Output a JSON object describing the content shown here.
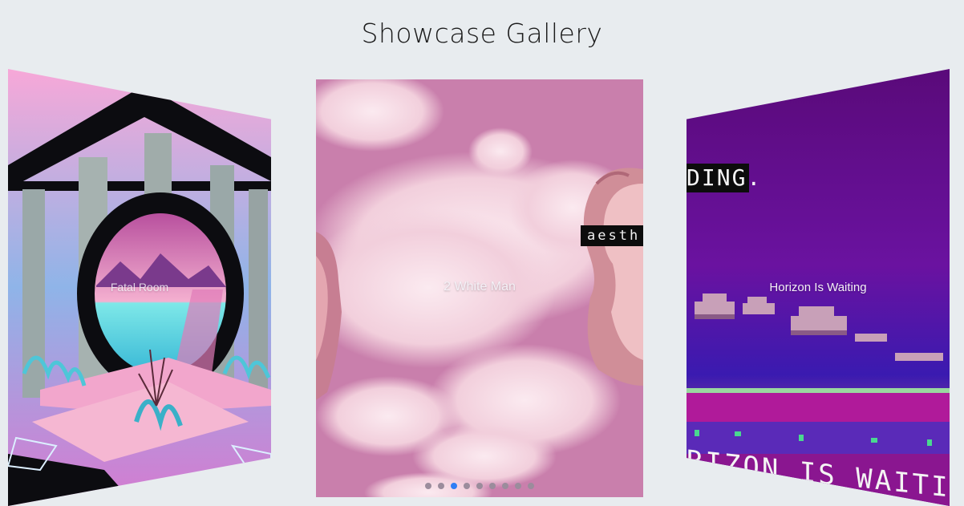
{
  "page": {
    "title": "Showcase Gallery"
  },
  "slides": [
    {
      "caption": "Fatal Room"
    },
    {
      "caption": "2 White Man",
      "overlay_text": "aesth"
    },
    {
      "caption": "Horizon Is Waiting",
      "top_text": "DING.",
      "bottom_text": "RIZON IS WAITING"
    }
  ],
  "pagination": {
    "count": 9,
    "active_index": 2
  },
  "colors": {
    "active_dot": "#2f7ef5",
    "inactive_dot": "#9b8c9c",
    "background": "#e8ecef"
  }
}
